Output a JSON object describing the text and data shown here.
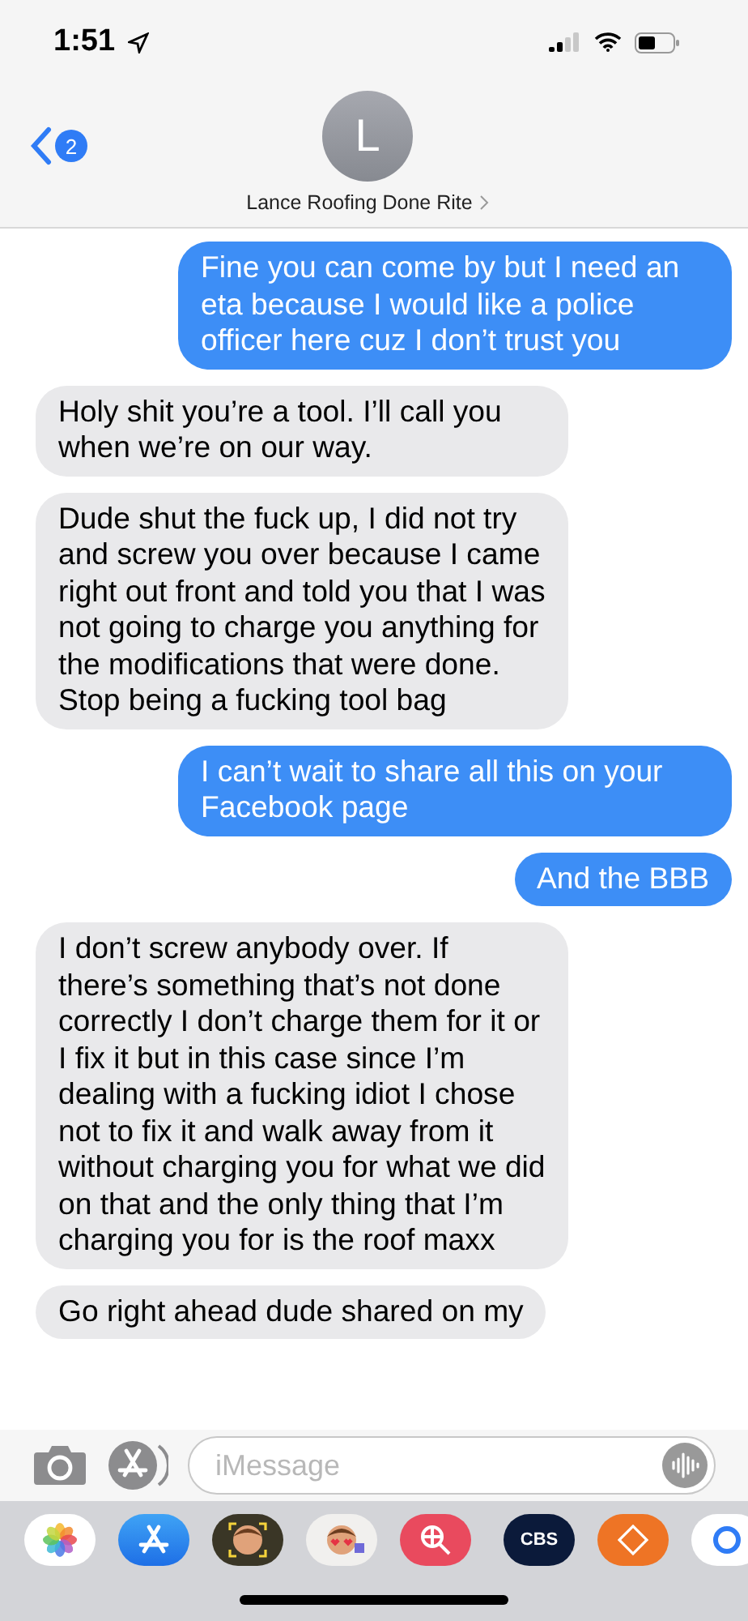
{
  "status_bar": {
    "time": "1:51"
  },
  "header": {
    "back_badge": "2",
    "avatar_initial": "L",
    "contact_name": "Lance Roofing Done Rite"
  },
  "messages": [
    {
      "kind": "sent",
      "text": "Fine you can come by but I need an eta because I would like a police officer here cuz I don’t trust you"
    },
    {
      "kind": "received",
      "text": "Holy shit you’re a tool. I’ll call you when we’re on our way."
    },
    {
      "kind": "received",
      "text": "Dude shut the fuck up, I did not try and screw you over because I came right out front and told you that I was not going to charge you anything for the modifications that were done. Stop being a fucking tool bag"
    },
    {
      "kind": "sent",
      "text": "I can’t wait to share all this on your Facebook page"
    },
    {
      "kind": "sent",
      "text": "And the BBB"
    },
    {
      "kind": "received",
      "text": "I don’t screw anybody over. If there’s something that’s not done correctly I don’t charge them for it or I fix it but in this case since I’m dealing with a fucking idiot I chose not to fix it and walk away from it without charging you for what we did on that and the only thing that I’m charging you for is the roof maxx"
    },
    {
      "kind": "received",
      "text": "Go right ahead dude shared on my"
    }
  ],
  "composer": {
    "placeholder": "iMessage"
  },
  "app_drawer": [
    {
      "kind": "photos"
    },
    {
      "kind": "appstore"
    },
    {
      "kind": "memoji"
    },
    {
      "kind": "stickers"
    },
    {
      "kind": "search"
    },
    {
      "kind": "divider"
    },
    {
      "kind": "cbs",
      "label": "CBS"
    },
    {
      "kind": "homedepot"
    },
    {
      "kind": "partial"
    }
  ]
}
